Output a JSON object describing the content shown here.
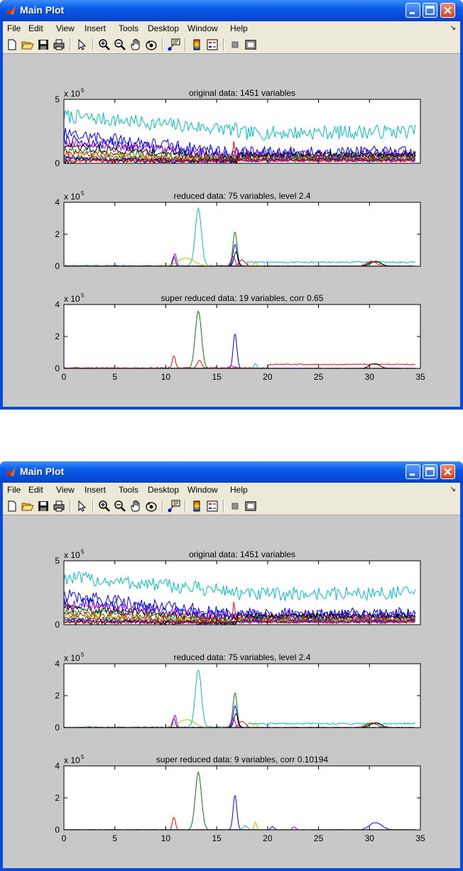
{
  "windows": [
    {
      "title": "Main Plot",
      "menu": [
        "File",
        "Edit",
        "View",
        "Insert",
        "Tools",
        "Desktop",
        "Window",
        "Help"
      ],
      "toolbar_icons": [
        "new-figure-icon",
        "open-file-icon",
        "save-icon",
        "print-icon",
        "arrow-pointer-icon",
        "zoom-in-icon",
        "zoom-out-icon",
        "pan-hand-icon",
        "rotate-3d-icon",
        "data-cursor-icon",
        "colorbar-icon",
        "legend-icon",
        "hide-plot-tools-icon",
        "show-plot-tools-icon"
      ],
      "subplots": [
        {
          "title": "original data: 1451 variables",
          "exponent_label": "x 10",
          "exponent": "5",
          "yticks": [
            "0",
            "5"
          ],
          "ymax": 5
        },
        {
          "title": "reduced data: 75 variables, level 2.4",
          "exponent_label": "x 10",
          "exponent": "5",
          "yticks": [
            "0",
            "2",
            "4"
          ],
          "ymax": 4
        },
        {
          "title": "super reduced data: 19 variables, corr 0.65",
          "exponent_label": "x 10",
          "exponent": "5",
          "yticks": [
            "0",
            "2",
            "4"
          ],
          "ymax": 4
        }
      ],
      "xticks": [
        "0",
        "5",
        "10",
        "15",
        "20",
        "25",
        "30",
        "35"
      ]
    },
    {
      "title": "Main Plot",
      "menu": [
        "File",
        "Edit",
        "View",
        "Insert",
        "Tools",
        "Desktop",
        "Window",
        "Help"
      ],
      "toolbar_icons": [
        "new-figure-icon",
        "open-file-icon",
        "save-icon",
        "print-icon",
        "arrow-pointer-icon",
        "zoom-in-icon",
        "zoom-out-icon",
        "pan-hand-icon",
        "rotate-3d-icon",
        "data-cursor-icon",
        "colorbar-icon",
        "legend-icon",
        "hide-plot-tools-icon",
        "show-plot-tools-icon"
      ],
      "subplots": [
        {
          "title": "original data: 1451 variables",
          "exponent_label": "x 10",
          "exponent": "5",
          "yticks": [
            "0",
            "5"
          ],
          "ymax": 5
        },
        {
          "title": "reduced data: 75 variables, level 2.4",
          "exponent_label": "x 10",
          "exponent": "5",
          "yticks": [
            "0",
            "2",
            "4"
          ],
          "ymax": 4
        },
        {
          "title": "super reduced data: 9 variables, corr 0.10194",
          "exponent_label": "x 10",
          "exponent": "5",
          "yticks": [
            "0",
            "2",
            "4"
          ],
          "ymax": 4
        }
      ],
      "xticks": [
        "0",
        "5",
        "10",
        "15",
        "20",
        "25",
        "30",
        "35"
      ]
    }
  ],
  "colors": {
    "titlebar": "#0a5be6",
    "figure_bg": "#c8c8c8",
    "menubar_bg": "#ece9d8",
    "series": [
      "#00bfbf",
      "#0000ff",
      "#008000",
      "#ff0000",
      "#bf00bf",
      "#000000",
      "#bfbf00"
    ]
  }
}
